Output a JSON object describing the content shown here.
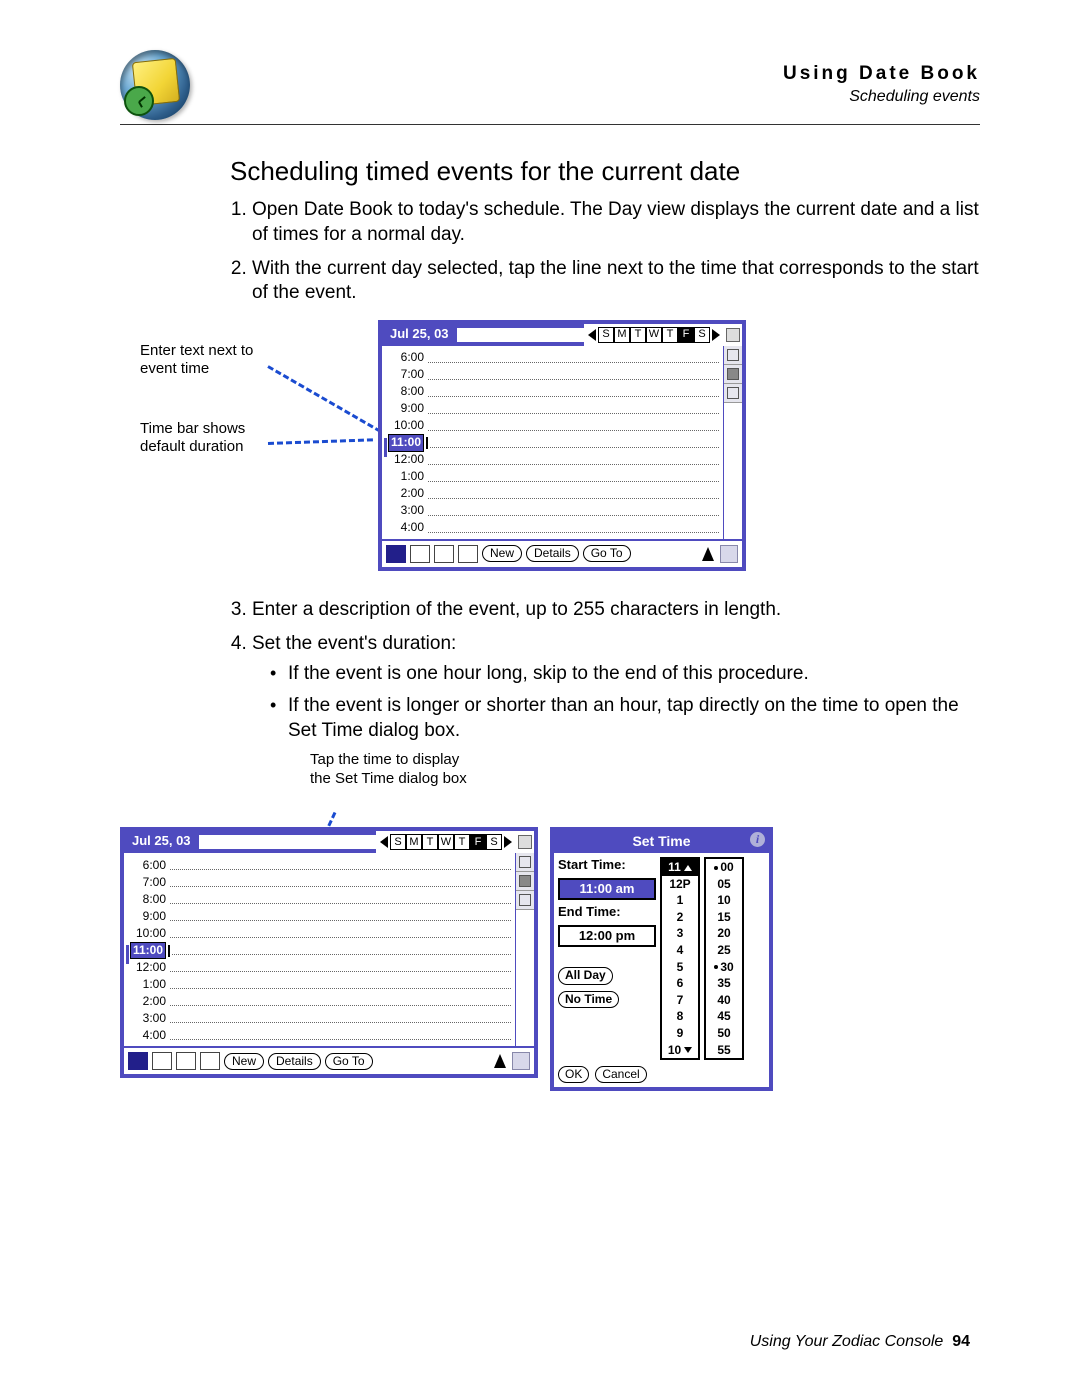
{
  "header": {
    "chapter": "Using Date Book",
    "section": "Scheduling events"
  },
  "content": {
    "h1": "Scheduling timed events for the current date",
    "step1": "Open Date Book to today's schedule. The Day view displays the current date and a list of times for a normal day.",
    "step2": "With the current day selected, tap the line next to the time that corresponds to the start of the event.",
    "step3": "Enter a description of the event, up to 255 characters in length.",
    "step4": "Set the event's duration:",
    "bullet1": "If the event is one hour long, skip to the end of this procedure.",
    "bullet2": "If the event is longer or shorter than an hour, tap directly on the time to open the Set Time dialog box."
  },
  "callouts": {
    "enter_text": "Enter text next to event time",
    "time_bar": "Time bar shows default duration",
    "tap_time": "Tap the time to display the Set Time dialog box"
  },
  "palm": {
    "date": "Jul 25, 03",
    "dow": [
      "S",
      "M",
      "T",
      "W",
      "T",
      "F",
      "S"
    ],
    "dow_selected_index": 5,
    "hours": [
      "6:00",
      "7:00",
      "8:00",
      "9:00",
      "10:00",
      "11:00",
      "12:00",
      "1:00",
      "2:00",
      "3:00",
      "4:00"
    ],
    "selected_hour_index": 5,
    "toolbar": {
      "new": "New",
      "details": "Details",
      "goto": "Go To"
    }
  },
  "settime": {
    "title": "Set Time",
    "start_label": "Start Time:",
    "start_value": "11:00 am",
    "end_label": "End Time:",
    "end_value": "12:00 pm",
    "all_day": "All Day",
    "no_time": "No Time",
    "hours_col": [
      "11",
      "12P",
      "1",
      "2",
      "3",
      "4",
      "5",
      "6",
      "7",
      "8",
      "9",
      "10"
    ],
    "mins_col": [
      "00",
      "05",
      "10",
      "15",
      "20",
      "25",
      "30",
      "35",
      "40",
      "45",
      "50",
      "55"
    ],
    "hours_sel_index": 0,
    "mins_marked": [
      0,
      6
    ],
    "ok": "OK",
    "cancel": "Cancel"
  },
  "footer": {
    "text": "Using Your Zodiac Console",
    "page": "94"
  }
}
